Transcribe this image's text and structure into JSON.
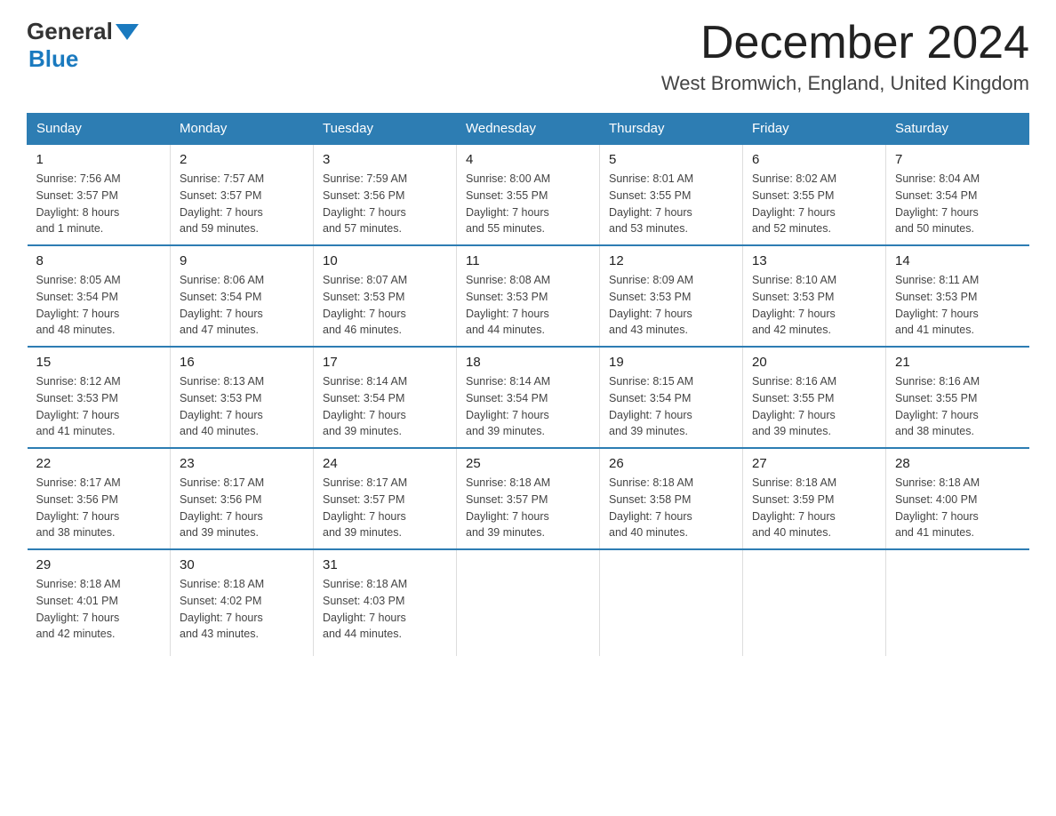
{
  "header": {
    "logo_general": "General",
    "logo_blue": "Blue",
    "month_year": "December 2024",
    "location": "West Bromwich, England, United Kingdom"
  },
  "days_of_week": [
    "Sunday",
    "Monday",
    "Tuesday",
    "Wednesday",
    "Thursday",
    "Friday",
    "Saturday"
  ],
  "weeks": [
    [
      {
        "day": "1",
        "info": "Sunrise: 7:56 AM\nSunset: 3:57 PM\nDaylight: 8 hours\nand 1 minute."
      },
      {
        "day": "2",
        "info": "Sunrise: 7:57 AM\nSunset: 3:57 PM\nDaylight: 7 hours\nand 59 minutes."
      },
      {
        "day": "3",
        "info": "Sunrise: 7:59 AM\nSunset: 3:56 PM\nDaylight: 7 hours\nand 57 minutes."
      },
      {
        "day": "4",
        "info": "Sunrise: 8:00 AM\nSunset: 3:55 PM\nDaylight: 7 hours\nand 55 minutes."
      },
      {
        "day": "5",
        "info": "Sunrise: 8:01 AM\nSunset: 3:55 PM\nDaylight: 7 hours\nand 53 minutes."
      },
      {
        "day": "6",
        "info": "Sunrise: 8:02 AM\nSunset: 3:55 PM\nDaylight: 7 hours\nand 52 minutes."
      },
      {
        "day": "7",
        "info": "Sunrise: 8:04 AM\nSunset: 3:54 PM\nDaylight: 7 hours\nand 50 minutes."
      }
    ],
    [
      {
        "day": "8",
        "info": "Sunrise: 8:05 AM\nSunset: 3:54 PM\nDaylight: 7 hours\nand 48 minutes."
      },
      {
        "day": "9",
        "info": "Sunrise: 8:06 AM\nSunset: 3:54 PM\nDaylight: 7 hours\nand 47 minutes."
      },
      {
        "day": "10",
        "info": "Sunrise: 8:07 AM\nSunset: 3:53 PM\nDaylight: 7 hours\nand 46 minutes."
      },
      {
        "day": "11",
        "info": "Sunrise: 8:08 AM\nSunset: 3:53 PM\nDaylight: 7 hours\nand 44 minutes."
      },
      {
        "day": "12",
        "info": "Sunrise: 8:09 AM\nSunset: 3:53 PM\nDaylight: 7 hours\nand 43 minutes."
      },
      {
        "day": "13",
        "info": "Sunrise: 8:10 AM\nSunset: 3:53 PM\nDaylight: 7 hours\nand 42 minutes."
      },
      {
        "day": "14",
        "info": "Sunrise: 8:11 AM\nSunset: 3:53 PM\nDaylight: 7 hours\nand 41 minutes."
      }
    ],
    [
      {
        "day": "15",
        "info": "Sunrise: 8:12 AM\nSunset: 3:53 PM\nDaylight: 7 hours\nand 41 minutes."
      },
      {
        "day": "16",
        "info": "Sunrise: 8:13 AM\nSunset: 3:53 PM\nDaylight: 7 hours\nand 40 minutes."
      },
      {
        "day": "17",
        "info": "Sunrise: 8:14 AM\nSunset: 3:54 PM\nDaylight: 7 hours\nand 39 minutes."
      },
      {
        "day": "18",
        "info": "Sunrise: 8:14 AM\nSunset: 3:54 PM\nDaylight: 7 hours\nand 39 minutes."
      },
      {
        "day": "19",
        "info": "Sunrise: 8:15 AM\nSunset: 3:54 PM\nDaylight: 7 hours\nand 39 minutes."
      },
      {
        "day": "20",
        "info": "Sunrise: 8:16 AM\nSunset: 3:55 PM\nDaylight: 7 hours\nand 39 minutes."
      },
      {
        "day": "21",
        "info": "Sunrise: 8:16 AM\nSunset: 3:55 PM\nDaylight: 7 hours\nand 38 minutes."
      }
    ],
    [
      {
        "day": "22",
        "info": "Sunrise: 8:17 AM\nSunset: 3:56 PM\nDaylight: 7 hours\nand 38 minutes."
      },
      {
        "day": "23",
        "info": "Sunrise: 8:17 AM\nSunset: 3:56 PM\nDaylight: 7 hours\nand 39 minutes."
      },
      {
        "day": "24",
        "info": "Sunrise: 8:17 AM\nSunset: 3:57 PM\nDaylight: 7 hours\nand 39 minutes."
      },
      {
        "day": "25",
        "info": "Sunrise: 8:18 AM\nSunset: 3:57 PM\nDaylight: 7 hours\nand 39 minutes."
      },
      {
        "day": "26",
        "info": "Sunrise: 8:18 AM\nSunset: 3:58 PM\nDaylight: 7 hours\nand 40 minutes."
      },
      {
        "day": "27",
        "info": "Sunrise: 8:18 AM\nSunset: 3:59 PM\nDaylight: 7 hours\nand 40 minutes."
      },
      {
        "day": "28",
        "info": "Sunrise: 8:18 AM\nSunset: 4:00 PM\nDaylight: 7 hours\nand 41 minutes."
      }
    ],
    [
      {
        "day": "29",
        "info": "Sunrise: 8:18 AM\nSunset: 4:01 PM\nDaylight: 7 hours\nand 42 minutes."
      },
      {
        "day": "30",
        "info": "Sunrise: 8:18 AM\nSunset: 4:02 PM\nDaylight: 7 hours\nand 43 minutes."
      },
      {
        "day": "31",
        "info": "Sunrise: 8:18 AM\nSunset: 4:03 PM\nDaylight: 7 hours\nand 44 minutes."
      },
      {
        "day": "",
        "info": ""
      },
      {
        "day": "",
        "info": ""
      },
      {
        "day": "",
        "info": ""
      },
      {
        "day": "",
        "info": ""
      }
    ]
  ]
}
